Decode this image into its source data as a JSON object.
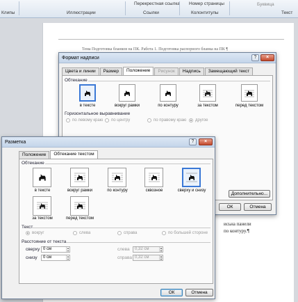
{
  "ribbon": {
    "items": [
      "Клипы",
      "Перекрестная ссылка",
      "Номер страницы",
      "Иллюстрации",
      "Ссылки",
      "Колонтитулы",
      "Буквица",
      "Текст"
    ]
  },
  "document": {
    "line1": "Тема Подготовка бланков на ПК. Работа 1. Подготовка распорного бланка на ПК ¶",
    "line2": "исьна панели",
    "line3": "по контуру.¶"
  },
  "format_dialog": {
    "title": "Формат надписи",
    "help": "?",
    "close": "×",
    "tabs": [
      "Цвета и линии",
      "Размер",
      "Положение",
      "Рисунок",
      "Надпись",
      "Замещающий текст"
    ],
    "wrap_group": "Обтекание",
    "wrap_options": [
      "в тексте",
      "вокруг рамки",
      "по контуру",
      "за текстом",
      "перед текстом"
    ],
    "align_group": "Горизонтальное выравнивание",
    "align_options": [
      "по левому краю",
      "по центру",
      "по правому краю",
      "другое"
    ],
    "advanced_button": "Дополнительно...",
    "ok": "ОК",
    "cancel": "Отмена"
  },
  "layout_dialog": {
    "title": "Разметка",
    "help": "?",
    "close": "×",
    "tabs": [
      "Положение",
      "Обтекание текстом"
    ],
    "wrap_group": "Обтекание",
    "wrap_options": [
      "в тексте",
      "вокруг рамки",
      "по контуру",
      "сквозное",
      "сверху и снизу",
      "за текстом",
      "перед текстом"
    ],
    "text_group": "Текст",
    "text_options": [
      "вокруг",
      "слева",
      "справа",
      "по большей стороне"
    ],
    "distance_group": "Расстояние от текста",
    "top_label": "сверху",
    "top_value": "0 см",
    "bottom_label": "снизу",
    "bottom_value": "0 см",
    "left_label": "слева",
    "left_value": "0,32 см",
    "right_label": "справа",
    "right_value": "0,32 см",
    "ok": "ОК",
    "cancel": "Отмена"
  }
}
